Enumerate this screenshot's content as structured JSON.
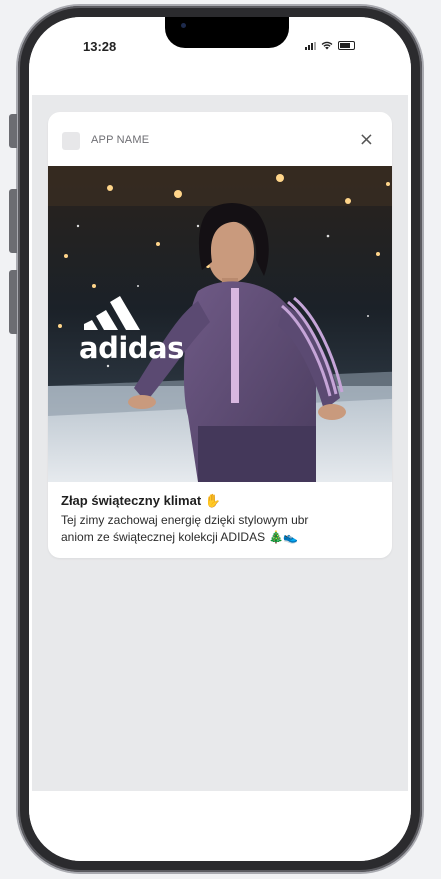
{
  "status_bar": {
    "time": "13:28"
  },
  "notification": {
    "app_name": "APP NAME",
    "close_label": "×",
    "brand": "adidas",
    "title": "Złap świąteczny klimat",
    "title_emoji": "✋",
    "body_line1": "Tej zimy zachowaj energię dzięki stylowym ubr",
    "body_line2": "aniom ze świątecznej kolekcji ADIDAS",
    "body_emoji": "🎄👟"
  }
}
